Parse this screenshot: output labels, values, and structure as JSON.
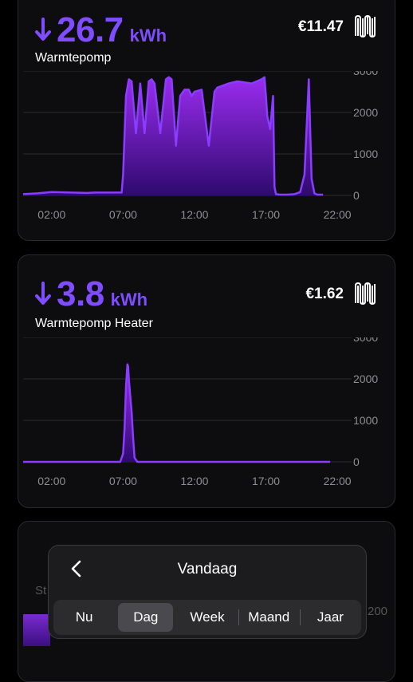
{
  "cards": [
    {
      "energy_value": "26.7",
      "energy_unit": "kWh",
      "name": "Warmtepomp",
      "cost": "€11.47",
      "icon": "radiator-icon",
      "y_ticks": [
        "3000",
        "2000",
        "1000",
        "0"
      ],
      "x_ticks": [
        "02:00",
        "07:00",
        "12:00",
        "17:00",
        "22:00"
      ]
    },
    {
      "energy_value": "3.8",
      "energy_unit": "kWh",
      "name": "Warmtepomp Heater",
      "cost": "€1.62",
      "icon": "radiator-icon",
      "y_ticks": [
        "3000",
        "2000",
        "1000",
        "0"
      ],
      "x_ticks": [
        "02:00",
        "07:00",
        "12:00",
        "17:00",
        "22:00"
      ]
    }
  ],
  "partial_card": {
    "name": "St",
    "y_tick": "200"
  },
  "period_selector": {
    "title": "Vandaag",
    "tabs": [
      "Nu",
      "Dag",
      "Week",
      "Maand",
      "Jaar"
    ],
    "active_tab": "Dag"
  },
  "colors": {
    "accent": "#7f4dff",
    "line": "#8a3cff",
    "fill_top": "#9b2cf0",
    "fill_bottom": "#2e0a6e"
  },
  "chart_data": [
    {
      "type": "area",
      "title": "",
      "xlabel": "",
      "ylabel": "",
      "ylim": [
        0,
        3000
      ],
      "x_unit": "hour",
      "x_ticks": [
        "02:00",
        "07:00",
        "12:00",
        "17:00",
        "22:00"
      ],
      "series": [
        {
          "x": [
            0.0,
            1.0,
            2.0,
            4.5,
            5.0,
            6.9,
            7.0,
            7.2,
            7.4,
            7.6,
            7.9,
            8.2,
            8.5,
            8.8,
            9.0,
            9.2,
            9.6,
            10.0,
            10.2,
            10.4,
            10.7,
            11.0,
            11.3,
            11.6,
            11.8,
            12.0,
            12.5,
            13.0,
            13.4,
            13.6,
            14.0,
            14.4,
            15.0,
            16.0,
            16.7,
            16.9,
            17.0,
            17.1,
            17.3,
            17.5,
            17.6,
            17.7,
            18.0,
            18.5,
            19.0,
            19.4,
            19.7,
            20.0,
            20.2,
            20.4,
            20.6,
            21.0
          ],
          "y": [
            30,
            50,
            80,
            60,
            70,
            70,
            500,
            2400,
            2800,
            2750,
            1500,
            2700,
            1500,
            2750,
            2800,
            2700,
            1500,
            2800,
            2850,
            2800,
            1200,
            2400,
            2550,
            2550,
            2400,
            2500,
            2550,
            1200,
            2500,
            2600,
            2650,
            2700,
            2750,
            2700,
            2800,
            2850,
            2400,
            1900,
            1600,
            2400,
            200,
            30,
            20,
            20,
            30,
            80,
            500,
            2800,
            400,
            50,
            20,
            20
          ]
        }
      ]
    },
    {
      "type": "area",
      "title": "",
      "xlabel": "",
      "ylabel": "",
      "ylim": [
        0,
        3000
      ],
      "x_unit": "hour",
      "x_ticks": [
        "02:00",
        "07:00",
        "12:00",
        "17:00",
        "22:00"
      ],
      "series": [
        {
          "x": [
            0.0,
            6.0,
            6.8,
            7.0,
            7.1,
            7.2,
            7.3,
            7.35,
            7.4,
            7.5,
            7.6,
            7.7,
            7.8,
            8.0,
            10.0,
            15.0,
            20.0,
            21.5
          ],
          "y": [
            0,
            0,
            0,
            200,
            800,
            1800,
            2350,
            2300,
            2000,
            1600,
            1200,
            600,
            100,
            0,
            0,
            0,
            0,
            0
          ]
        }
      ]
    }
  ]
}
